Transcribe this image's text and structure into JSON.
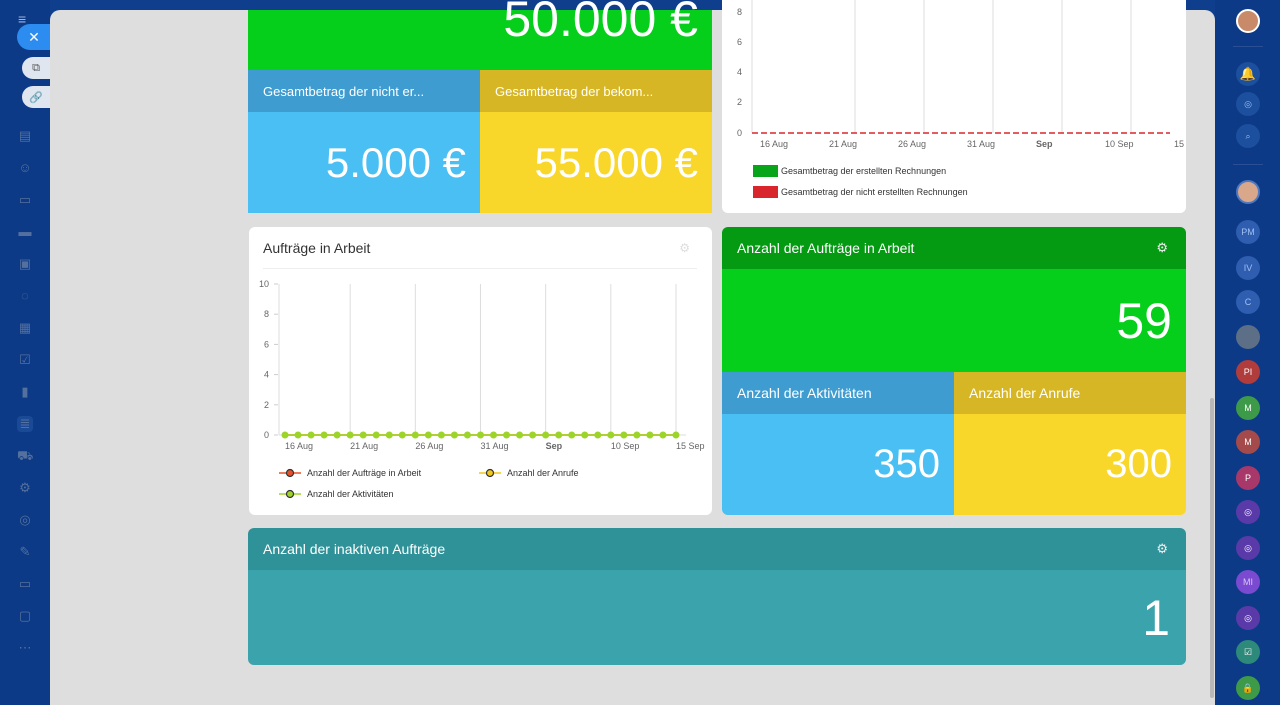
{
  "colors": {
    "green": "#06cf1c",
    "green_head": "#049a12",
    "blue": "#49bff3",
    "blue_head": "#3f9cd0",
    "yellow": "#f9d72a",
    "yellow_head": "#d6b624",
    "teal": "#3aa3ac",
    "teal_head": "#2f9298"
  },
  "top_tiles": {
    "big_value": "50.000 €",
    "not_created_label": "Gesamtbetrag der nicht er...",
    "not_created_value": "5.000 €",
    "received_label": "Gesamtbetrag der bekom...",
    "received_value": "55.000 €"
  },
  "invoice_chart": {
    "y_ticks": [
      "8",
      "6",
      "4",
      "2",
      "0"
    ],
    "x_ticks": [
      "16 Aug",
      "21 Aug",
      "26 Aug",
      "31 Aug",
      "Sep",
      "10 Sep",
      "15 Sep"
    ],
    "legend": [
      {
        "label": "Gesamtbetrag der erstellten Rechnungen",
        "color": "#08a51a"
      },
      {
        "label": "Gesamtbetrag der nicht erstellten Rechnungen",
        "color": "#d9262c"
      }
    ]
  },
  "orders_chart_card": {
    "title": "Aufträge in Arbeit",
    "legend": [
      {
        "label": "Anzahl der Aufträge in Arbeit",
        "line": "#e8502a",
        "marker": "#555"
      },
      {
        "label": "Anzahl der Anrufe",
        "line": "#f2c919",
        "marker": "#555"
      },
      {
        "label": "Anzahl der Aktivitäten",
        "line": "#9dd42a",
        "marker": "#555"
      }
    ]
  },
  "chart_data": {
    "type": "line",
    "title": "Aufträge in Arbeit",
    "xlabel": "",
    "ylabel": "",
    "ylim": [
      0,
      10
    ],
    "y_ticks": [
      "10",
      "8",
      "6",
      "4",
      "2",
      "0"
    ],
    "x_ticks": [
      "16 Aug",
      "21 Aug",
      "26 Aug",
      "31 Aug",
      "Sep",
      "10 Sep",
      "15 Sep"
    ],
    "x": [
      "16 Aug",
      "17 Aug",
      "18 Aug",
      "19 Aug",
      "20 Aug",
      "21 Aug",
      "22 Aug",
      "23 Aug",
      "24 Aug",
      "25 Aug",
      "26 Aug",
      "27 Aug",
      "28 Aug",
      "29 Aug",
      "30 Aug",
      "31 Aug",
      "1 Sep",
      "2 Sep",
      "3 Sep",
      "4 Sep",
      "5 Sep",
      "6 Sep",
      "7 Sep",
      "8 Sep",
      "9 Sep",
      "10 Sep",
      "11 Sep",
      "12 Sep",
      "13 Sep",
      "14 Sep",
      "15 Sep"
    ],
    "series": [
      {
        "name": "Anzahl der Aufträge in Arbeit",
        "color": "#e8502a",
        "values": [
          0,
          0,
          0,
          0,
          0,
          0,
          0,
          0,
          0,
          0,
          0,
          0,
          0,
          0,
          0,
          0,
          0,
          0,
          0,
          0,
          0,
          0,
          0,
          0,
          0,
          0,
          0,
          0,
          0,
          0,
          0
        ]
      },
      {
        "name": "Anzahl der Anrufe",
        "color": "#f2c919",
        "values": [
          0,
          0,
          0,
          0,
          0,
          0,
          0,
          0,
          0,
          0,
          0,
          0,
          0,
          0,
          0,
          0,
          0,
          0,
          0,
          0,
          0,
          0,
          0,
          0,
          0,
          0,
          0,
          0,
          0,
          0,
          0
        ]
      },
      {
        "name": "Anzahl der Aktivitäten",
        "color": "#9dd42a",
        "values": [
          0,
          0,
          0,
          0,
          0,
          0,
          0,
          0,
          0,
          0,
          0,
          0,
          0,
          0,
          0,
          0,
          0,
          0,
          0,
          0,
          0,
          0,
          0,
          0,
          0,
          0,
          0,
          0,
          0,
          0,
          0
        ]
      }
    ],
    "legend_position": "bottom",
    "grid": true
  },
  "orders_in_work": {
    "label": "Anzahl der Aufträge in Arbeit",
    "value": "59"
  },
  "activities": {
    "label": "Anzahl der Aktivitäten",
    "value": "350"
  },
  "calls": {
    "label": "Anzahl der Anrufe",
    "value": "300"
  },
  "inactive_orders": {
    "label": "Anzahl der inaktiven Aufträge",
    "value": "1"
  },
  "right_rail": {
    "avatars": [
      "PM",
      "IV",
      "C",
      "",
      "PI",
      "M",
      "M",
      "P",
      "",
      "",
      "MI",
      "",
      "",
      ""
    ]
  }
}
